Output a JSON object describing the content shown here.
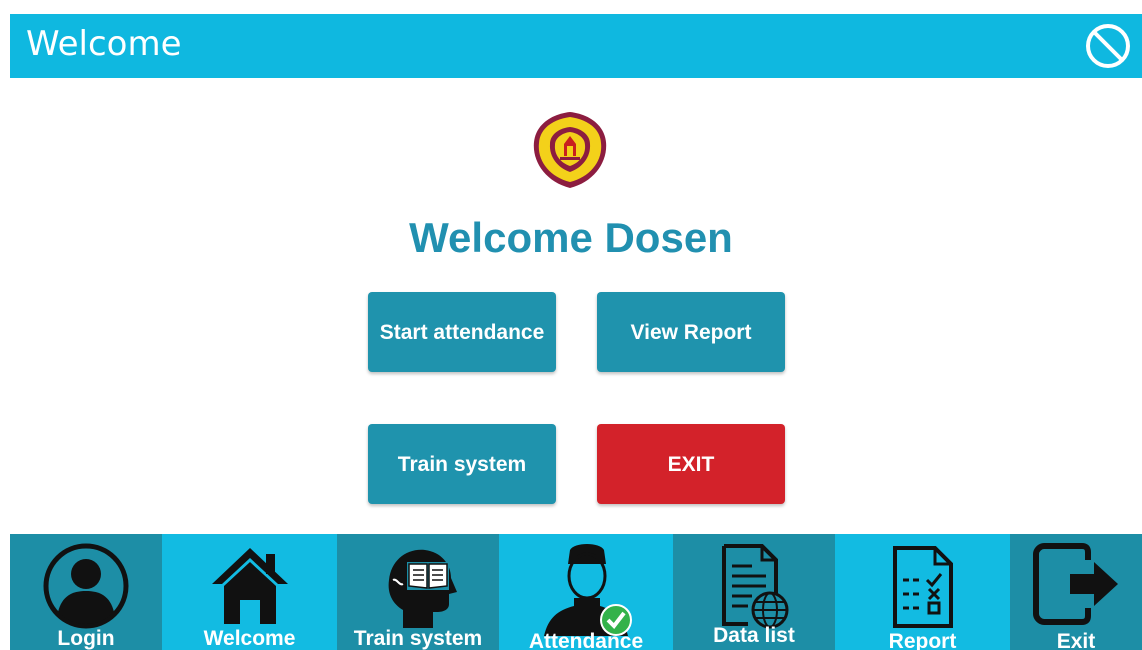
{
  "window": {
    "title": "Welcome"
  },
  "main": {
    "logo_alt": "Universitas Klabat",
    "headline": "Welcome Dosen",
    "buttons": {
      "start_attendance": "Start attendance",
      "view_report": "View Report",
      "train_system": "Train system",
      "exit": "EXIT"
    }
  },
  "bottom_nav": {
    "items": [
      {
        "label": "Login",
        "icon": "user-circle-icon"
      },
      {
        "label": "Welcome",
        "icon": "home-icon"
      },
      {
        "label": "Train system",
        "icon": "head-book-icon"
      },
      {
        "label": "Attendance",
        "icon": "person-check-icon"
      },
      {
        "label": "Data list",
        "icon": "document-globe-icon"
      },
      {
        "label": "Report",
        "icon": "checklist-icon"
      },
      {
        "label": "Exit",
        "icon": "exit-door-icon"
      }
    ]
  },
  "colors": {
    "titlebar": "#0fb8e0",
    "accent_text": "#2190b0",
    "button_teal": "#1f93ad",
    "button_red": "#d3222a",
    "nav_dark": "#1d8ea6",
    "nav_light": "#12bbe2"
  }
}
